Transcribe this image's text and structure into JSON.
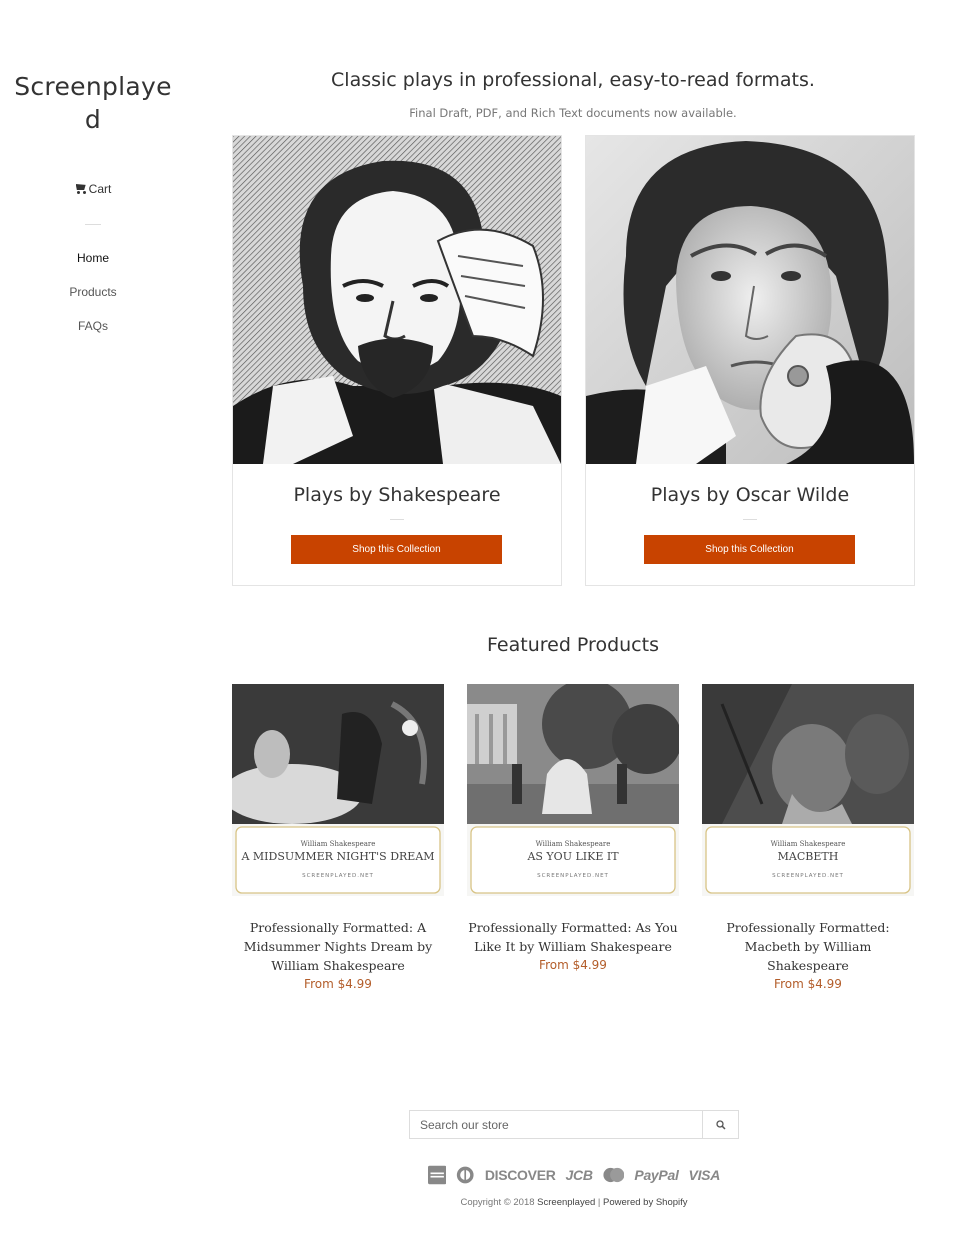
{
  "sidebar": {
    "logo": "Screenplayed",
    "cart_label": "Cart",
    "nav": [
      "Home",
      "Products",
      "FAQs"
    ]
  },
  "hero": {
    "title": "Classic plays in professional, easy-to-read formats.",
    "subtitle": "Final Draft, PDF, and Rich Text documents now available."
  },
  "collections": [
    {
      "title": "Plays by Shakespeare",
      "button": "Shop this Collection"
    },
    {
      "title": "Plays by Oscar Wilde",
      "button": "Shop this Collection"
    }
  ],
  "featured": {
    "title": "Featured Products",
    "products": [
      {
        "card_author": "William Shakespeare",
        "card_title": "A MIDSUMMER NIGHT'S DREAM",
        "card_site": "SCREENPLAYED.NET",
        "title": "Professionally Formatted: A Midsummer Nights Dream by William Shakespeare",
        "price": "From $4.99"
      },
      {
        "card_author": "William Shakespeare",
        "card_title": "AS YOU LIKE IT",
        "card_site": "SCREENPLAYED.NET",
        "title": "Professionally Formatted: As You Like It by William Shakespeare",
        "price": "From $4.99"
      },
      {
        "card_author": "William Shakespeare",
        "card_title": "MACBETH",
        "card_site": "SCREENPLAYED.NET",
        "title": "Professionally Formatted: Macbeth by William Shakespeare",
        "price": "From $4.99"
      }
    ]
  },
  "footer": {
    "search_placeholder": "Search our store",
    "payments": [
      "American Express",
      "Diners Club",
      "DISCOVER",
      "JCB",
      "MasterCard",
      "PayPal",
      "VISA"
    ],
    "copyright_prefix": "Copyright © 2018 ",
    "store_link": "Screenplayed",
    "separator": " | ",
    "powered_by": "Powered by Shopify"
  },
  "colors": {
    "button": "#c84300",
    "price": "#b35d2a"
  }
}
